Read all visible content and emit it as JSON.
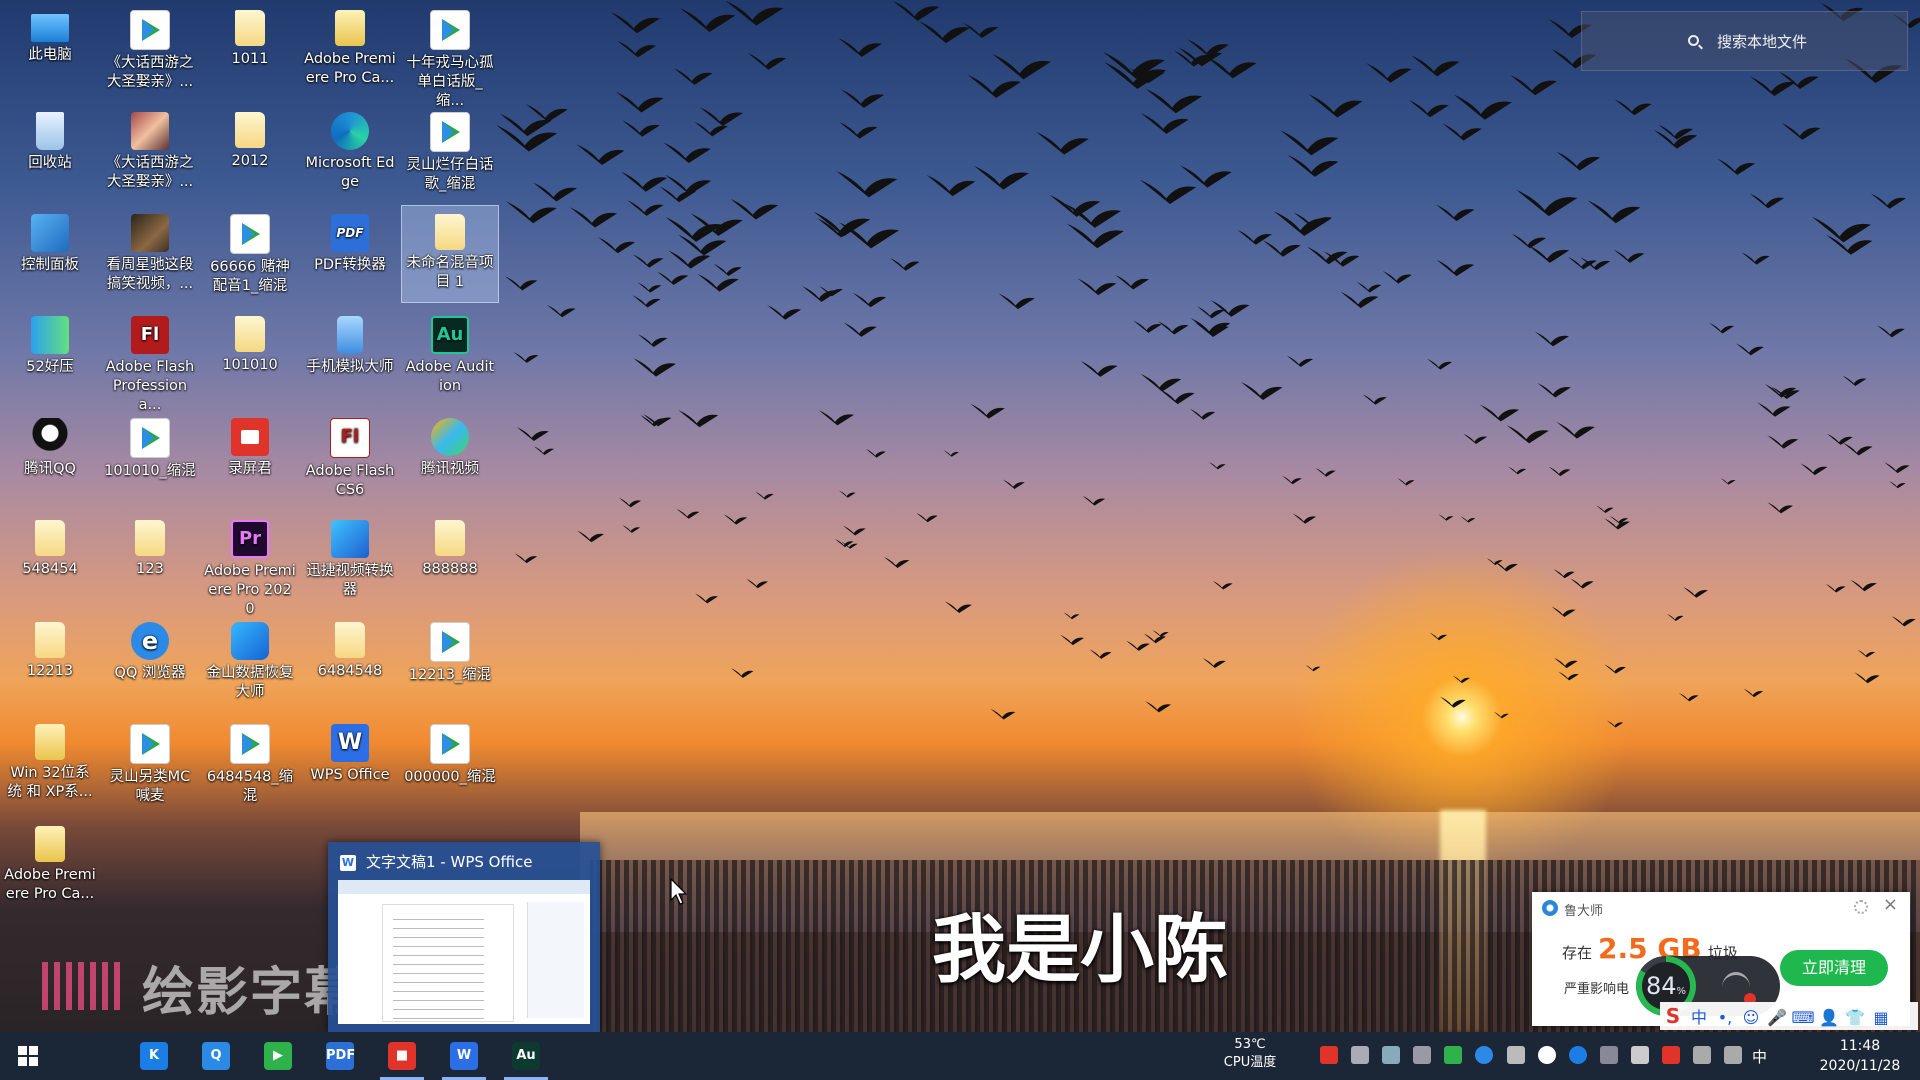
{
  "search": {
    "label": "搜索本地文件"
  },
  "desktop_icons": [
    {
      "label": "此电脑",
      "type": "pc"
    },
    {
      "label": "《大话西游之大圣娶亲》...",
      "type": "video"
    },
    {
      "label": "1011",
      "type": "folder"
    },
    {
      "label": "Adobe Premiere Pro Ca...",
      "type": "folderzip"
    },
    {
      "label": "十年戎马心孤单白话版_缩...",
      "type": "video"
    },
    {
      "label": "回收站",
      "type": "bin"
    },
    {
      "label": "《大话西游之大圣娶亲》...",
      "type": "photo"
    },
    {
      "label": "2012",
      "type": "folder"
    },
    {
      "label": "Microsoft Edge",
      "type": "edge"
    },
    {
      "label": "灵山烂仔白话歌_缩混",
      "type": "video"
    },
    {
      "label": "控制面板",
      "type": "panel"
    },
    {
      "label": "看周星驰这段搞笑视频，...",
      "type": "photo2"
    },
    {
      "label": "66666 赌神配音1_缩混",
      "type": "video"
    },
    {
      "label": "PDF转换器",
      "type": "pdf"
    },
    {
      "label": "未命名混音项目 1",
      "type": "folder"
    },
    {
      "label": "52好压",
      "type": "zip"
    },
    {
      "label": "Adobe Flash Professiona...",
      "type": "flash"
    },
    {
      "label": "101010",
      "type": "folder"
    },
    {
      "label": "手机模拟大师",
      "type": "phone"
    },
    {
      "label": "Adobe Audition",
      "type": "au"
    },
    {
      "label": "腾讯QQ",
      "type": "qq"
    },
    {
      "label": "101010_缩混",
      "type": "video"
    },
    {
      "label": "录屏君",
      "type": "rec"
    },
    {
      "label": "Adobe Flash CS6",
      "type": "flashcs6"
    },
    {
      "label": "腾讯视频",
      "type": "qqv"
    },
    {
      "label": "548454",
      "type": "folder"
    },
    {
      "label": "123",
      "type": "folder"
    },
    {
      "label": "Adobe Premiere Pro 2020",
      "type": "pr"
    },
    {
      "label": "迅捷视频转换器",
      "type": "xunjie"
    },
    {
      "label": "888888",
      "type": "folder"
    },
    {
      "label": "12213",
      "type": "folder"
    },
    {
      "label": "QQ 浏览器",
      "type": "ie"
    },
    {
      "label": "金山数据恢复大师",
      "type": "jinshan"
    },
    {
      "label": "6484548",
      "type": "folder"
    },
    {
      "label": "12213_缩混",
      "type": "video"
    },
    {
      "label": "Win 32位系统 和 XP系...",
      "type": "folderzip"
    },
    {
      "label": "灵山另类MC喊麦",
      "type": "video"
    },
    {
      "label": "6484548_缩混",
      "type": "video"
    },
    {
      "label": "WPS Office",
      "type": "wps"
    },
    {
      "label": "000000_缩混",
      "type": "video"
    },
    {
      "label": "Adobe Premiere Pro Ca...",
      "type": "folderzip"
    }
  ],
  "subtitle": "我是小陈",
  "watermark": "绘影字幕",
  "wps_preview": {
    "title": "文字文稿1 - WPS Office",
    "icon": "W"
  },
  "ludashi": {
    "title": "鲁大师",
    "prefix": "存在",
    "amount": "2.5 GB",
    "suffix": "垃圾",
    "warning": "严重影响电",
    "clean_button": "立即清理"
  },
  "net_monitor": {
    "percent": "84",
    "unit": "%"
  },
  "ime_toolbar": {
    "s": "S",
    "zh": "中",
    "punct": "•,",
    "emoji": "☺",
    "mic": "🎤",
    "kbd": "⌨",
    "user": "👤",
    "shirt": "👕",
    "grid": "▦"
  },
  "taskbar": {
    "cpu_temp": "53℃",
    "cpu_label": "CPU温度",
    "ime": "中",
    "time": "11:48",
    "date": "2020/11/28",
    "apps": [
      {
        "name": "kugou",
        "glyph": "K",
        "color": "#1a7ee6"
      },
      {
        "name": "qq-browser",
        "glyph": "Q",
        "color": "#2a8ae6"
      },
      {
        "name": "tencent-video",
        "glyph": "▶",
        "color": "#2fb24b"
      },
      {
        "name": "pdf-converter",
        "glyph": "PDF",
        "color": "#2d6fd8"
      },
      {
        "name": "screen-recorder",
        "glyph": "■",
        "color": "#e0342a"
      },
      {
        "name": "wps",
        "glyph": "W",
        "color": "#2c6ee6"
      },
      {
        "name": "audition",
        "glyph": "Au",
        "color": "#0c3a2e"
      }
    ]
  },
  "colors": {
    "taskbar": "#1b2636",
    "clean_button": "#1fb84e",
    "accent_orange": "#f26b1d"
  }
}
